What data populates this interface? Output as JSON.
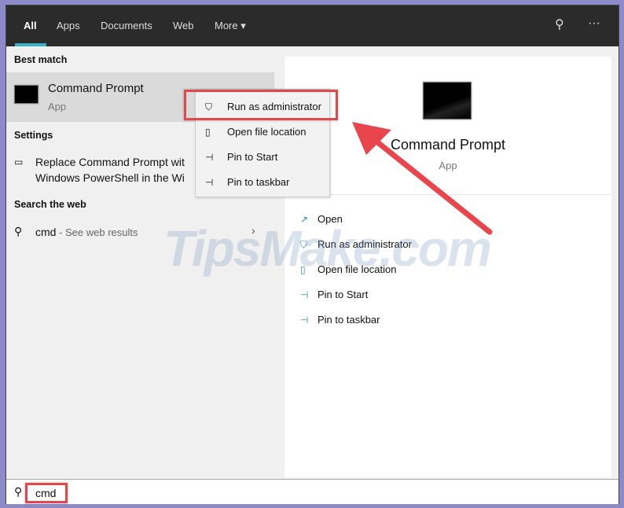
{
  "tabs": [
    "All",
    "Apps",
    "Documents",
    "Web",
    "More ▾"
  ],
  "header_icons": {
    "feedback": "feedback-icon",
    "more": "···"
  },
  "left": {
    "best_match": "Best match",
    "app_name": "Command Prompt",
    "app_type": "App",
    "settings": "Settings",
    "setting_line1": "Replace Command Prompt wit",
    "setting_line2": "Windows PowerShell in the Wi",
    "search_web": "Search the web",
    "web_query": "cmd",
    "web_suffix": " - See web results"
  },
  "context_menu": [
    "Run as administrator",
    "Open file location",
    "Pin to Start",
    "Pin to taskbar"
  ],
  "right": {
    "app_name": "Command Prompt",
    "app_type": "App",
    "actions": [
      "Open",
      "Run as administrator",
      "Open file location",
      "Pin to Start",
      "Pin to taskbar"
    ]
  },
  "search": {
    "value": "cmd"
  },
  "watermark": "TipsMake.com",
  "colors": {
    "accent": "#3ab3c7",
    "highlight": "#e0484e"
  }
}
